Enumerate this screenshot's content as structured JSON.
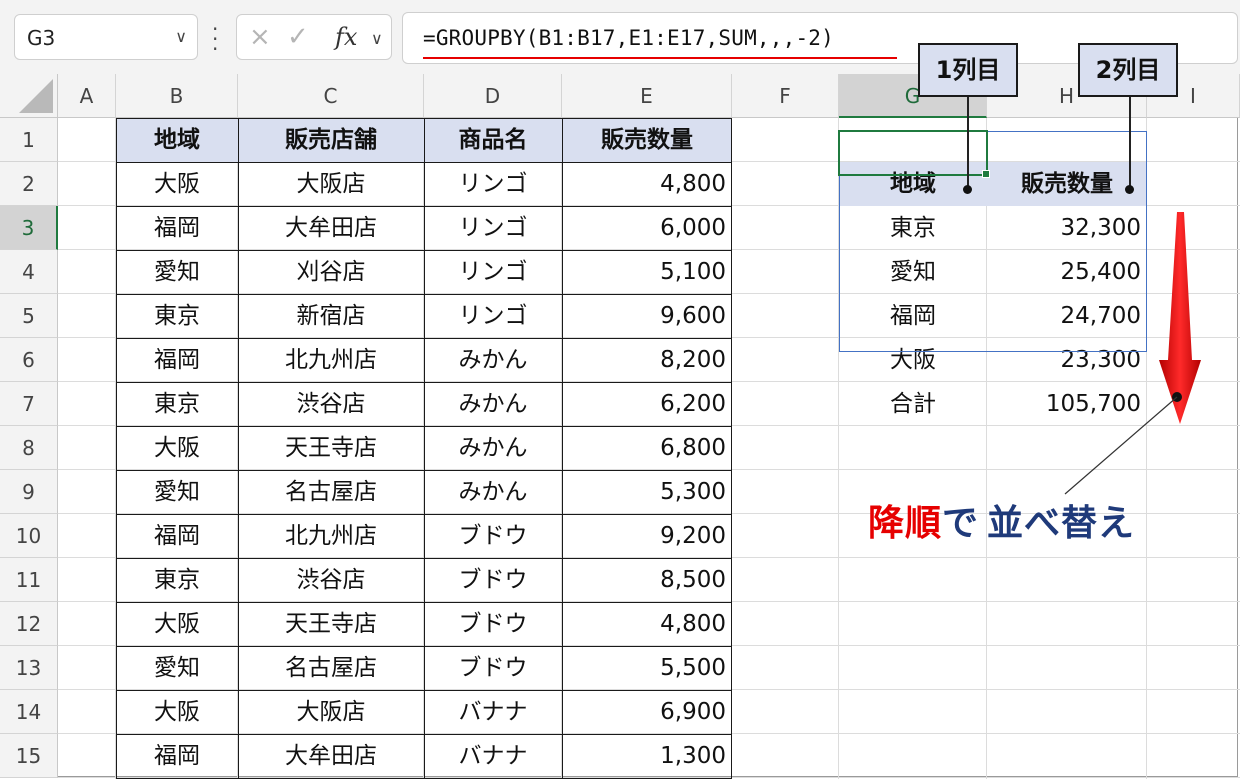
{
  "formula_bar": {
    "name_box": "G3",
    "cancel_icon": "×",
    "enter_icon": "✓",
    "fx_label": "fx",
    "formula": "=GROUPBY(B1:B17,E1:E17,SUM,,,-2)"
  },
  "columns": [
    "A",
    "B",
    "C",
    "D",
    "E",
    "F",
    "G",
    "H",
    "I"
  ],
  "rows": [
    "1",
    "2",
    "3",
    "4",
    "5",
    "6",
    "7",
    "8",
    "9",
    "10",
    "11",
    "12",
    "13",
    "14",
    "15"
  ],
  "source_table": {
    "headers": [
      "地域",
      "販売店舗",
      "商品名",
      "販売数量"
    ],
    "rows": [
      [
        "大阪",
        "大阪店",
        "リンゴ",
        "4,800"
      ],
      [
        "福岡",
        "大牟田店",
        "リンゴ",
        "6,000"
      ],
      [
        "愛知",
        "刈谷店",
        "リンゴ",
        "5,100"
      ],
      [
        "東京",
        "新宿店",
        "リンゴ",
        "9,600"
      ],
      [
        "福岡",
        "北九州店",
        "みかん",
        "8,200"
      ],
      [
        "東京",
        "渋谷店",
        "みかん",
        "6,200"
      ],
      [
        "大阪",
        "天王寺店",
        "みかん",
        "6,800"
      ],
      [
        "愛知",
        "名古屋店",
        "みかん",
        "5,300"
      ],
      [
        "福岡",
        "北九州店",
        "ブドウ",
        "9,200"
      ],
      [
        "東京",
        "渋谷店",
        "ブドウ",
        "8,500"
      ],
      [
        "大阪",
        "天王寺店",
        "ブドウ",
        "4,800"
      ],
      [
        "愛知",
        "名古屋店",
        "ブドウ",
        "5,500"
      ],
      [
        "大阪",
        "大阪店",
        "バナナ",
        "6,900"
      ],
      [
        "福岡",
        "大牟田店",
        "バナナ",
        "1,300"
      ]
    ]
  },
  "result_table": {
    "headers": [
      "地域",
      "販売数量"
    ],
    "rows": [
      [
        "東京",
        "32,300"
      ],
      [
        "愛知",
        "25,400"
      ],
      [
        "福岡",
        "24,700"
      ],
      [
        "大阪",
        "23,300"
      ],
      [
        "合計",
        "105,700"
      ]
    ]
  },
  "callouts": {
    "col1": "1列目",
    "col2": "2列目",
    "sort_red": "降順",
    "sort_navy_1": "で",
    "sort_navy_2": "並べ替え"
  },
  "colors": {
    "header_fill": "#d9dff0",
    "arrow_red": "#e60000",
    "selection_green": "#1f7a3f",
    "spill_border": "#4472c4"
  }
}
